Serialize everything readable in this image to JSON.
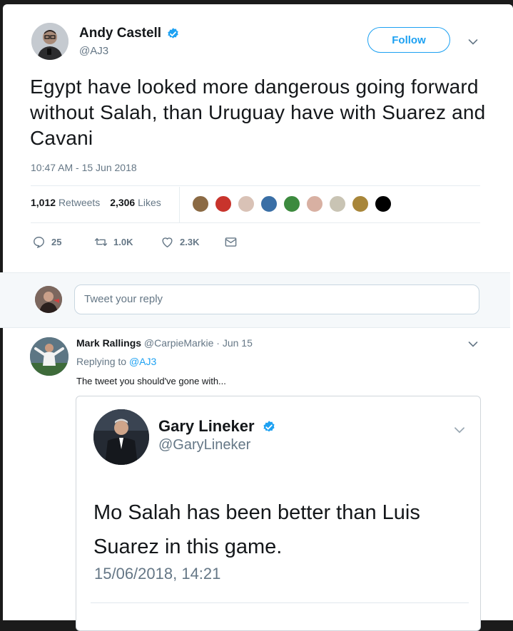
{
  "tweet": {
    "author_name": "Andy Castell",
    "author_handle": "@AJ3",
    "follow_label": "Follow",
    "text": "Egypt have looked more dangerous going forward without Salah, than Uruguay have with Suarez and Cavani",
    "timestamp": "10:47 AM - 15 Jun 2018",
    "retweets_count": "1,012",
    "retweets_label": "Retweets",
    "likes_count": "2,306",
    "likes_label": "Likes",
    "actions": {
      "reply_count": "25",
      "retweet_count": "1.0K",
      "like_count": "2.3K"
    },
    "colors": {
      "accent": "#1da1f2",
      "text": "#14171a",
      "muted": "#657786"
    }
  },
  "reply_box": {
    "placeholder": "Tweet your reply"
  },
  "reply": {
    "author_name": "Mark Rallings",
    "author_handle": "@CarpieMarkie",
    "date": "· Jun 15",
    "replying_to_label": "Replying to",
    "replying_to_handle": "@AJ3",
    "text": "The tweet you should've gone with..."
  },
  "embedded_tweet": {
    "author_name": "Gary Lineker",
    "author_handle": "@GaryLineker",
    "text": "Mo Salah has been better than Luis Suarez in this game.",
    "timestamp": "15/06/2018, 14:21"
  },
  "icons": {
    "verified": "verified-badge-icon",
    "caret": "chevron-down-icon",
    "reply": "reply-icon",
    "retweet": "retweet-icon",
    "like": "heart-icon",
    "dm": "envelope-icon"
  }
}
